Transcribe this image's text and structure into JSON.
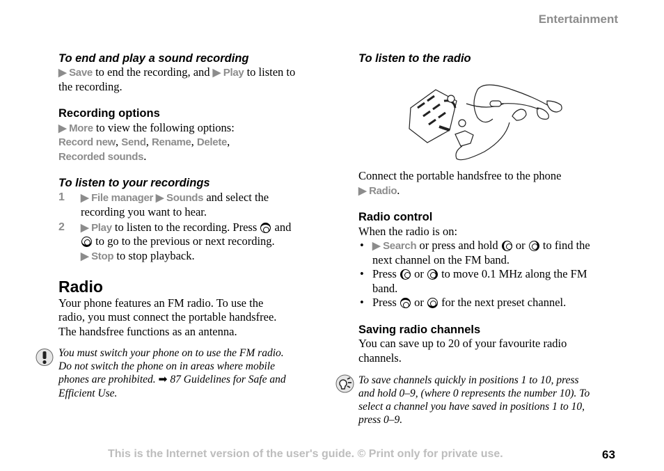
{
  "header": {
    "section": "Entertainment"
  },
  "footer": {
    "notice": "This is the Internet version of the user's guide. © Print only for private use.",
    "page_number": "63"
  },
  "icons": {
    "warning": "exclamation-icon",
    "tip": "lightbulb-tip-icon",
    "keys": "navigation-key-icon",
    "illustration": "phone-handsfree-connection-illustration"
  },
  "colors": {
    "menu_text": "#8c8c8c",
    "footer_text": "#bdbdbd"
  },
  "lines": [
    {
      "k": "h",
      "segs": [
        {
          "t": "To end and play a sound recording"
        }
      ]
    },
    {
      "k": "p",
      "segs": [
        {
          "t": "▶ Save",
          "s": "m"
        },
        {
          "t": " to end the recording, and "
        },
        {
          "t": "▶ Play",
          "s": "m"
        },
        {
          "t": " to listen to"
        }
      ]
    },
    {
      "k": "p",
      "segs": [
        {
          "t": "the recording."
        }
      ]
    },
    {
      "k": "h2",
      "segs": [
        {
          "t": "Recording options"
        }
      ]
    },
    {
      "k": "p",
      "segs": [
        {
          "t": "▶ More",
          "s": "m"
        },
        {
          "t": " to view the following options:"
        }
      ]
    },
    {
      "k": "p",
      "segs": [
        {
          "t": "Record new",
          "s": "m"
        },
        {
          "t": ", "
        },
        {
          "t": "Send",
          "s": "m"
        },
        {
          "t": ", "
        },
        {
          "t": "Rename",
          "s": "m"
        },
        {
          "t": ", "
        },
        {
          "t": "Delete",
          "s": "m"
        },
        {
          "t": ","
        }
      ]
    },
    {
      "k": "p",
      "segs": [
        {
          "t": "Recorded sounds",
          "s": "m"
        },
        {
          "t": "."
        }
      ]
    },
    {
      "k": "h",
      "segs": [
        {
          "t": "To listen to your recordings"
        }
      ]
    },
    {
      "k": "num",
      "segs": [
        {
          "t": "1"
        }
      ]
    },
    {
      "k": "p",
      "segs": [
        {
          "t": "▶ File manager ▶ Sounds",
          "s": "m"
        },
        {
          "t": " and select the"
        }
      ]
    },
    {
      "k": "p",
      "segs": [
        {
          "t": "recording you want to hear."
        }
      ]
    },
    {
      "k": "num",
      "segs": [
        {
          "t": "2"
        }
      ]
    },
    {
      "k": "p",
      "segs": [
        {
          "t": "▶ Play",
          "s": "m"
        },
        {
          "t": " to listen to the recording. Press "
        },
        {
          "t": "up",
          "s": "key"
        },
        {
          "t": " and"
        }
      ]
    },
    {
      "k": "p",
      "segs": [
        {
          "t": "down",
          "s": "key"
        },
        {
          "t": " to go to the previous or next recording."
        }
      ]
    },
    {
      "k": "p",
      "segs": [
        {
          "t": "▶ Stop",
          "s": "m"
        },
        {
          "t": " to stop playback."
        }
      ]
    },
    {
      "k": "r",
      "segs": [
        {
          "t": "Radio"
        }
      ]
    },
    {
      "k": "p",
      "segs": [
        {
          "t": "Your phone features an FM radio. To use the"
        }
      ]
    },
    {
      "k": "p",
      "segs": [
        {
          "t": "radio, you must connect the portable handsfree."
        }
      ]
    },
    {
      "k": "p",
      "segs": [
        {
          "t": "The handsfree functions as an antenna."
        }
      ]
    },
    {
      "k": "n",
      "segs": [
        {
          "t": "You must switch your phone on to use the FM radio."
        }
      ]
    },
    {
      "k": "n",
      "segs": [
        {
          "t": "Do not switch the phone on in areas where mobile"
        }
      ]
    },
    {
      "k": "n",
      "segs": [
        {
          "t": "phones are prohibited. "
        },
        {
          "t": "➡",
          "s": "arrow"
        },
        {
          "t": " 87 Guidelines for Safe and"
        }
      ]
    },
    {
      "k": "n",
      "segs": [
        {
          "t": "Efficient Use."
        }
      ]
    },
    {
      "k": "h",
      "segs": [
        {
          "t": "To listen to the radio"
        }
      ]
    },
    {
      "k": "p",
      "segs": [
        {
          "t": "Connect the portable handsfree to the phone"
        }
      ]
    },
    {
      "k": "p",
      "segs": [
        {
          "t": "▶ Radio",
          "s": "m"
        },
        {
          "t": "."
        }
      ]
    },
    {
      "k": "h2",
      "segs": [
        {
          "t": "Radio control"
        }
      ]
    },
    {
      "k": "p",
      "segs": [
        {
          "t": "When the radio is on:"
        }
      ]
    },
    {
      "k": "b",
      "segs": [
        {
          "t": "•"
        }
      ]
    },
    {
      "k": "p",
      "segs": [
        {
          "t": "▶ Search",
          "s": "m"
        },
        {
          "t": " or press and hold "
        },
        {
          "t": "left",
          "s": "key"
        },
        {
          "t": " or "
        },
        {
          "t": "right",
          "s": "key"
        },
        {
          "t": " to find the"
        }
      ]
    },
    {
      "k": "p",
      "segs": [
        {
          "t": "next channel on the FM band."
        }
      ]
    },
    {
      "k": "b",
      "segs": [
        {
          "t": "•"
        }
      ]
    },
    {
      "k": "p",
      "segs": [
        {
          "t": "Press "
        },
        {
          "t": "left",
          "s": "key"
        },
        {
          "t": " or "
        },
        {
          "t": "right",
          "s": "key"
        },
        {
          "t": " to move 0.1 MHz along the FM"
        }
      ]
    },
    {
      "k": "p",
      "segs": [
        {
          "t": "band."
        }
      ]
    },
    {
      "k": "b",
      "segs": [
        {
          "t": "•"
        }
      ]
    },
    {
      "k": "p",
      "segs": [
        {
          "t": "Press "
        },
        {
          "t": "up",
          "s": "key"
        },
        {
          "t": " or "
        },
        {
          "t": "down",
          "s": "key"
        },
        {
          "t": " for the next preset channel."
        }
      ]
    },
    {
      "k": "h2",
      "segs": [
        {
          "t": "Saving radio channels"
        }
      ]
    },
    {
      "k": "p",
      "segs": [
        {
          "t": "You can save up to 20 of your favourite radio"
        }
      ]
    },
    {
      "k": "p",
      "segs": [
        {
          "t": "channels."
        }
      ]
    },
    {
      "k": "n",
      "segs": [
        {
          "t": "To save channels quickly in positions 1 to 10, press"
        }
      ]
    },
    {
      "k": "n",
      "segs": [
        {
          "t": "and hold 0–9, (where 0 represents the number 10). To"
        }
      ]
    },
    {
      "k": "n",
      "segs": [
        {
          "t": "select a channel you have saved in positions 1 to 10,"
        }
      ]
    },
    {
      "k": "n",
      "segs": [
        {
          "t": "press 0–9."
        }
      ]
    }
  ]
}
